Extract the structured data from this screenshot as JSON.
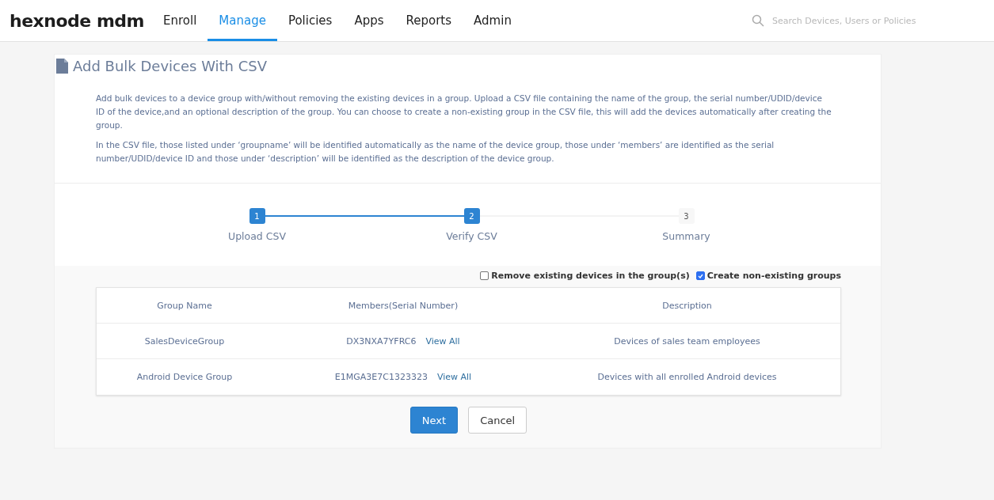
{
  "brand": "hexnode mdm",
  "nav": [
    {
      "label": "Enroll",
      "selected": false
    },
    {
      "label": "Manage",
      "selected": true
    },
    {
      "label": "Policies",
      "selected": false
    },
    {
      "label": "Apps",
      "selected": false
    },
    {
      "label": "Reports",
      "selected": false
    },
    {
      "label": "Admin",
      "selected": false
    }
  ],
  "search": {
    "placeholder": "Search Devices, Users or Policies"
  },
  "page": {
    "title": "Add Bulk Devices With CSV",
    "paragraphs": [
      "Add bulk devices to a device group with/without removing the existing devices in a group. Upload a CSV file containing the name of the group, the serial number/UDID/device ID of the device,and an optional description of the group. You can choose to create a non-existing group in the CSV file, this will add the devices automatically after creating the group.",
      "In the CSV file, those listed under ‘groupname’ will be identified automatically as the name of the device group, those under ‘members’ are identified as the serial number/UDID/device ID and those under ‘description’ will be identified as the description of the device group."
    ]
  },
  "steps": [
    {
      "number": "1",
      "label": "Upload CSV",
      "completed": true
    },
    {
      "number": "2",
      "label": "Verify CSV",
      "completed": true
    },
    {
      "number": "3",
      "label": "Summary",
      "completed": false
    }
  ],
  "options": [
    {
      "label": "Remove existing devices in the group(s)",
      "checked": false
    },
    {
      "label": "Create non-existing groups",
      "checked": true
    }
  ],
  "table": {
    "columns": [
      "Group Name",
      "Members(Serial Number)",
      "Description"
    ],
    "rows": [
      {
        "group": "SalesDeviceGroup",
        "member": "DX3NXA7YFRC6",
        "link": "View All",
        "description": "Devices of sales team employees"
      },
      {
        "group": "Android Device Group",
        "member": "E1MGA3E7C1323323",
        "link": "View All",
        "description": "Devices with all enrolled Android devices"
      }
    ]
  },
  "buttons": [
    {
      "label": "Next",
      "kind": "primary"
    },
    {
      "label": "Cancel",
      "kind": "secondary"
    }
  ]
}
